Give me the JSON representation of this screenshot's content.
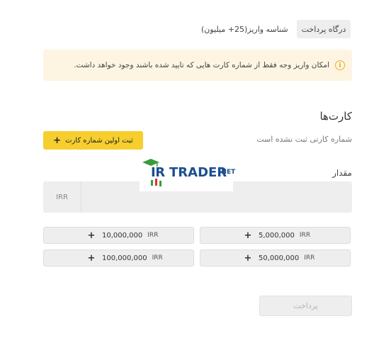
{
  "tabs": {
    "payment_gateway": "درگاه پرداخت",
    "deposit_id": "شناسه واریز(25+ میلیون)"
  },
  "notice": {
    "icon": "info-icon",
    "text": "امکان واریز وجه فقط از شماره کارت هایی که تایید شده باشند وجود خواهد داشت."
  },
  "cards": {
    "title": "کارت‌ها",
    "empty_message": "شماره کارتی ثبت نشده است",
    "add_button_label": "ثبت اولین شماره کارت",
    "add_button_icon": "plus-icon"
  },
  "amount": {
    "label": "مقدار",
    "currency": "IRR",
    "value": ""
  },
  "watermark": {
    "ir": "IR",
    "trader": "TRADER",
    "net": ".NET"
  },
  "presets": [
    {
      "value": "5,000,000",
      "currency": "IRR"
    },
    {
      "value": "10,000,000",
      "currency": "IRR"
    },
    {
      "value": "50,000,000",
      "currency": "IRR"
    },
    {
      "value": "100,000,000",
      "currency": "IRR"
    }
  ],
  "pay_button_label": "پرداخت",
  "colors": {
    "accent": "#f6ce2e",
    "notice_bg": "#fdf5e2",
    "field_bg": "#eeeeee"
  }
}
